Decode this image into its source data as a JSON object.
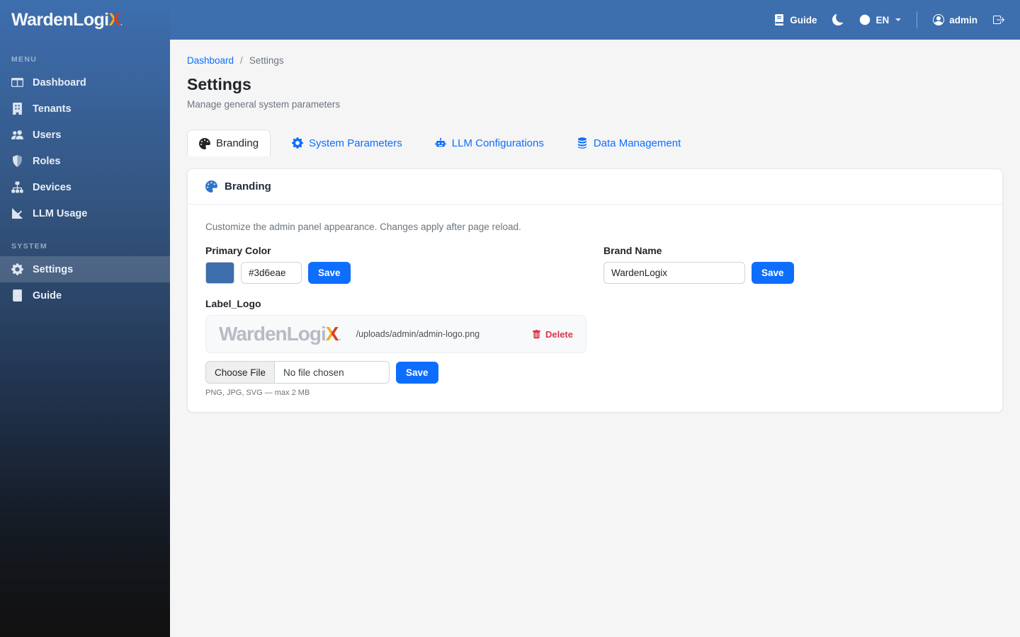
{
  "brand": {
    "text": "WardenLogi",
    "x": "X",
    "dot": "."
  },
  "topbar": {
    "guide": "Guide",
    "language": "EN",
    "username": "admin"
  },
  "sidebar": {
    "menu_header": "MENU",
    "items": [
      {
        "label": "Dashboard",
        "icon": "dashboard-icon"
      },
      {
        "label": "Tenants",
        "icon": "building-icon"
      },
      {
        "label": "Users",
        "icon": "users-icon"
      },
      {
        "label": "Roles",
        "icon": "shield-icon"
      },
      {
        "label": "Devices",
        "icon": "sitemap-icon"
      },
      {
        "label": "LLM Usage",
        "icon": "chart-line-icon"
      }
    ],
    "system_header": "SYSTEM",
    "system_items": [
      {
        "label": "Settings",
        "icon": "gear-icon",
        "active": true
      },
      {
        "label": "Guide",
        "icon": "book-icon",
        "active": false
      }
    ]
  },
  "breadcrumb": {
    "parent": "Dashboard",
    "separator": "/",
    "current": "Settings"
  },
  "page": {
    "title": "Settings",
    "subtitle": "Manage general system parameters"
  },
  "tabs": [
    {
      "label": "Branding",
      "icon": "palette-icon",
      "active": true
    },
    {
      "label": "System Parameters",
      "icon": "gear-icon",
      "active": false
    },
    {
      "label": "LLM Configurations",
      "icon": "robot-icon",
      "active": false
    },
    {
      "label": "Data Management",
      "icon": "database-icon",
      "active": false
    }
  ],
  "branding_card": {
    "title": "Branding",
    "intro": "Customize the admin panel appearance. Changes apply after page reload.",
    "primary_color_label": "Primary Color",
    "primary_color_value": "#3d6eae",
    "brand_name_label": "Brand Name",
    "brand_name_value": "WardenLogix",
    "save_label": "Save",
    "logo_label": "Label_Logo",
    "logo_path": "/uploads/admin/admin-logo.png",
    "delete_label": "Delete",
    "choose_file_label": "Choose File",
    "file_status": "No file chosen",
    "upload_hint": "PNG, JPG, SVG — max 2 MB"
  },
  "colors": {
    "primary": "#3d6eae",
    "link_blue": "#0d6efd",
    "danger": "#dc3545"
  }
}
